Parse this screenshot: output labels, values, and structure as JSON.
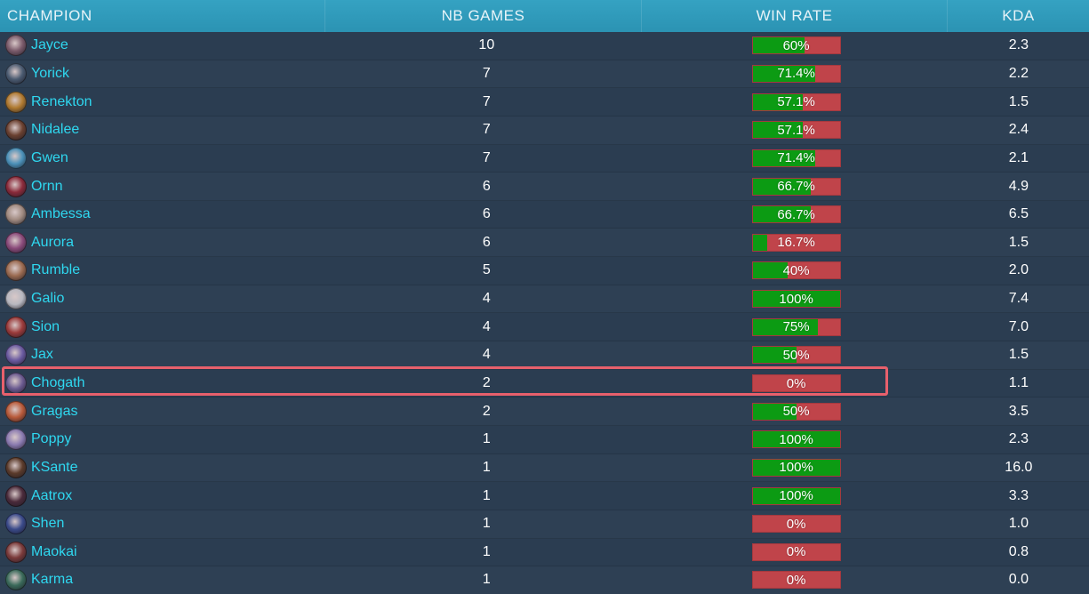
{
  "header": {
    "champion": "CHAMPION",
    "games": "NB GAMES",
    "winrate": "WIN RATE",
    "kda": "KDA"
  },
  "colors": {
    "win": "#0c9b13",
    "loss": "#c0444a",
    "name": "#2fd8f0",
    "highlight": "#e8606c"
  },
  "rows": [
    {
      "name": "Jayce",
      "games": "10",
      "winrate": "60%",
      "win_fraction": 0.6,
      "kda": "2.3",
      "avatar": "#7a5a6a"
    },
    {
      "name": "Yorick",
      "games": "7",
      "winrate": "71.4%",
      "win_fraction": 0.714,
      "kda": "2.2",
      "avatar": "#4a5a70"
    },
    {
      "name": "Renekton",
      "games": "7",
      "winrate": "57.1%",
      "win_fraction": 0.571,
      "kda": "1.5",
      "avatar": "#b07a30"
    },
    {
      "name": "Nidalee",
      "games": "7",
      "winrate": "57.1%",
      "win_fraction": 0.571,
      "kda": "2.4",
      "avatar": "#6a4030"
    },
    {
      "name": "Gwen",
      "games": "7",
      "winrate": "71.4%",
      "win_fraction": 0.714,
      "kda": "2.1",
      "avatar": "#4a90b8"
    },
    {
      "name": "Ornn",
      "games": "6",
      "winrate": "66.7%",
      "win_fraction": 0.667,
      "kda": "4.9",
      "avatar": "#8a2a3a"
    },
    {
      "name": "Ambessa",
      "games": "6",
      "winrate": "66.7%",
      "win_fraction": 0.667,
      "kda": "6.5",
      "avatar": "#a08a80"
    },
    {
      "name": "Aurora",
      "games": "6",
      "winrate": "16.7%",
      "win_fraction": 0.167,
      "kda": "1.5",
      "avatar": "#8a4a7a"
    },
    {
      "name": "Rumble",
      "games": "5",
      "winrate": "40%",
      "win_fraction": 0.4,
      "kda": "2.0",
      "avatar": "#9a6a50"
    },
    {
      "name": "Galio",
      "games": "4",
      "winrate": "100%",
      "win_fraction": 1.0,
      "kda": "7.4",
      "avatar": "#b8b8c0"
    },
    {
      "name": "Sion",
      "games": "4",
      "winrate": "75%",
      "win_fraction": 0.75,
      "kda": "7.0",
      "avatar": "#9a3a3a"
    },
    {
      "name": "Jax",
      "games": "4",
      "winrate": "50%",
      "win_fraction": 0.5,
      "kda": "1.5",
      "avatar": "#6a5aa0"
    },
    {
      "name": "Chogath",
      "games": "2",
      "winrate": "0%",
      "win_fraction": 0.0,
      "kda": "1.1",
      "avatar": "#6a5a90"
    },
    {
      "name": "Gragas",
      "games": "2",
      "winrate": "50%",
      "win_fraction": 0.5,
      "kda": "3.5",
      "avatar": "#b85a3a"
    },
    {
      "name": "Poppy",
      "games": "1",
      "winrate": "100%",
      "win_fraction": 1.0,
      "kda": "2.3",
      "avatar": "#8a7ab0"
    },
    {
      "name": "KSante",
      "games": "1",
      "winrate": "100%",
      "win_fraction": 1.0,
      "kda": "16.0",
      "avatar": "#5a3a2a"
    },
    {
      "name": "Aatrox",
      "games": "1",
      "winrate": "100%",
      "win_fraction": 1.0,
      "kda": "3.3",
      "avatar": "#4a2a3a"
    },
    {
      "name": "Shen",
      "games": "1",
      "winrate": "0%",
      "win_fraction": 0.0,
      "kda": "1.0",
      "avatar": "#3a4a8a"
    },
    {
      "name": "Maokai",
      "games": "1",
      "winrate": "0%",
      "win_fraction": 0.0,
      "kda": "0.8",
      "avatar": "#7a3a3a"
    },
    {
      "name": "Karma",
      "games": "1",
      "winrate": "0%",
      "win_fraction": 0.0,
      "kda": "0.0",
      "avatar": "#3a6a5a"
    }
  ]
}
